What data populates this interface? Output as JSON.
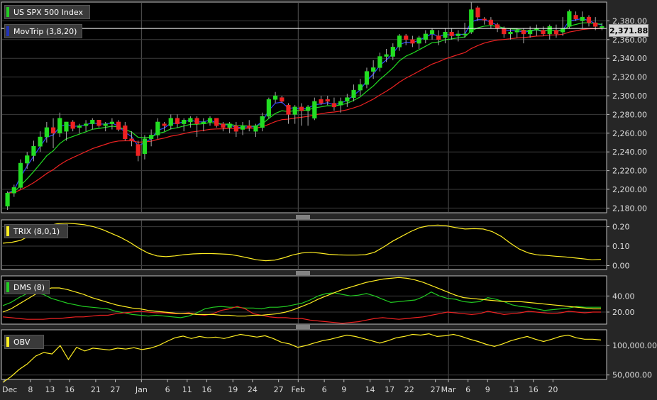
{
  "chart_data": [
    {
      "type": "candlestick",
      "panel": "price",
      "series": [
        {
          "name": "US SPX 500 Index",
          "color": "#22cc22",
          "legend_swatch": "#22cc22"
        },
        {
          "name": "MovTrip (3,8,20)",
          "legend_swatch": "#2233bb",
          "lines": [
            "#3344ff",
            "#22dd22",
            "#ee2222"
          ]
        }
      ],
      "last_value_label": "2,371.88",
      "last_value": 2371.88,
      "ylim": [
        2175,
        2400
      ],
      "yticks": [
        {
          "v": 2180,
          "label": "2,180.00"
        },
        {
          "v": 2200,
          "label": "2,200.00"
        },
        {
          "v": 2220,
          "label": "2,220.00"
        },
        {
          "v": 2240,
          "label": "2,240.00"
        },
        {
          "v": 2260,
          "label": "2,260.00"
        },
        {
          "v": 2280,
          "label": "2,280.00"
        },
        {
          "v": 2300,
          "label": "2,300.00"
        },
        {
          "v": 2320,
          "label": "2,320.00"
        },
        {
          "v": 2340,
          "label": "2,340.00"
        },
        {
          "v": 2360,
          "label": "2,360.00"
        },
        {
          "v": 2380,
          "label": "2,380.00"
        }
      ],
      "candles": [
        [
          2182,
          2198,
          2178,
          2196
        ],
        [
          2196,
          2205,
          2192,
          2202
        ],
        [
          2202,
          2232,
          2200,
          2228
        ],
        [
          2228,
          2240,
          2222,
          2236
        ],
        [
          2236,
          2252,
          2230,
          2246
        ],
        [
          2246,
          2262,
          2240,
          2256
        ],
        [
          2256,
          2272,
          2250,
          2266
        ],
        [
          2266,
          2276,
          2244,
          2260
        ],
        [
          2260,
          2282,
          2256,
          2276
        ],
        [
          2262,
          2272,
          2252,
          2272
        ],
        [
          2272,
          2274,
          2262,
          2265
        ],
        [
          2266,
          2270,
          2260,
          2268
        ],
        [
          2268,
          2274,
          2262,
          2270
        ],
        [
          2270,
          2276,
          2264,
          2274
        ],
        [
          2274,
          2274,
          2266,
          2268
        ],
        [
          2268,
          2272,
          2262,
          2270
        ],
        [
          2270,
          2276,
          2264,
          2272
        ],
        [
          2272,
          2274,
          2262,
          2264
        ],
        [
          2268,
          2272,
          2252,
          2254
        ],
        [
          2254,
          2262,
          2246,
          2252
        ],
        [
          2248,
          2252,
          2230,
          2236
        ],
        [
          2238,
          2258,
          2232,
          2254
        ],
        [
          2254,
          2264,
          2246,
          2258
        ],
        [
          2258,
          2276,
          2254,
          2272
        ],
        [
          2270,
          2272,
          2262,
          2268
        ],
        [
          2268,
          2280,
          2264,
          2276
        ],
        [
          2276,
          2280,
          2266,
          2270
        ],
        [
          2270,
          2276,
          2262,
          2274
        ],
        [
          2272,
          2278,
          2266,
          2276
        ],
        [
          2276,
          2278,
          2256,
          2270
        ],
        [
          2270,
          2276,
          2262,
          2272
        ],
        [
          2272,
          2278,
          2268,
          2276
        ],
        [
          2276,
          2276,
          2266,
          2268
        ],
        [
          2270,
          2272,
          2262,
          2266
        ],
        [
          2266,
          2272,
          2260,
          2270
        ],
        [
          2268,
          2272,
          2256,
          2262
        ],
        [
          2264,
          2272,
          2258,
          2268
        ],
        [
          2268,
          2274,
          2262,
          2266
        ],
        [
          2262,
          2270,
          2256,
          2268
        ],
        [
          2266,
          2282,
          2262,
          2278
        ],
        [
          2278,
          2298,
          2276,
          2296
        ],
        [
          2296,
          2304,
          2292,
          2300
        ],
        [
          2298,
          2300,
          2292,
          2294
        ],
        [
          2290,
          2292,
          2270,
          2280
        ],
        [
          2280,
          2290,
          2270,
          2288
        ],
        [
          2288,
          2292,
          2268,
          2284
        ],
        [
          2284,
          2290,
          2268,
          2288
        ],
        [
          2276,
          2298,
          2274,
          2294
        ],
        [
          2296,
          2300,
          2290,
          2292
        ],
        [
          2296,
          2300,
          2290,
          2294
        ],
        [
          2292,
          2298,
          2284,
          2288
        ],
        [
          2290,
          2298,
          2282,
          2294
        ],
        [
          2294,
          2302,
          2288,
          2298
        ],
        [
          2298,
          2312,
          2294,
          2306
        ],
        [
          2306,
          2318,
          2300,
          2312
        ],
        [
          2312,
          2330,
          2308,
          2326
        ],
        [
          2326,
          2338,
          2318,
          2330
        ],
        [
          2330,
          2346,
          2326,
          2342
        ],
        [
          2342,
          2350,
          2336,
          2344
        ],
        [
          2342,
          2356,
          2338,
          2352
        ],
        [
          2352,
          2366,
          2348,
          2364
        ],
        [
          2364,
          2366,
          2354,
          2360
        ],
        [
          2360,
          2364,
          2352,
          2356
        ],
        [
          2356,
          2364,
          2350,
          2362
        ],
        [
          2360,
          2370,
          2356,
          2366
        ],
        [
          2366,
          2372,
          2360,
          2370
        ],
        [
          2364,
          2370,
          2354,
          2360
        ],
        [
          2362,
          2372,
          2356,
          2368
        ],
        [
          2368,
          2372,
          2360,
          2364
        ],
        [
          2364,
          2370,
          2358,
          2366
        ],
        [
          2366,
          2378,
          2362,
          2366
        ],
        [
          2368,
          2400,
          2366,
          2392
        ],
        [
          2394,
          2396,
          2380,
          2384
        ],
        [
          2382,
          2384,
          2376,
          2381
        ],
        [
          2381,
          2384,
          2372,
          2376
        ],
        [
          2376,
          2378,
          2368,
          2372
        ],
        [
          2372,
          2374,
          2362,
          2366
        ],
        [
          2366,
          2372,
          2360,
          2368
        ],
        [
          2368,
          2372,
          2362,
          2370
        ],
        [
          2370,
          2372,
          2356,
          2366
        ],
        [
          2366,
          2374,
          2362,
          2370
        ],
        [
          2370,
          2376,
          2364,
          2372
        ],
        [
          2370,
          2374,
          2364,
          2366
        ],
        [
          2366,
          2376,
          2360,
          2374
        ],
        [
          2370,
          2376,
          2362,
          2366
        ],
        [
          2368,
          2384,
          2364,
          2372
        ],
        [
          2374,
          2392,
          2372,
          2390
        ],
        [
          2386,
          2390,
          2380,
          2382
        ],
        [
          2380,
          2390,
          2372,
          2384
        ],
        [
          2384,
          2386,
          2374,
          2378
        ],
        [
          2378,
          2384,
          2370,
          2374
        ],
        [
          2374,
          2378,
          2370,
          2374
        ]
      ]
    },
    {
      "type": "line",
      "panel": "trix",
      "series": [
        {
          "name": "TRIX (8,0,1)",
          "color": "#ffee22",
          "values": [
            0.115,
            0.12,
            0.13,
            0.155,
            0.185,
            0.205,
            0.215,
            0.218,
            0.215,
            0.21,
            0.2,
            0.185,
            0.165,
            0.145,
            0.12,
            0.09,
            0.065,
            0.05,
            0.046,
            0.05,
            0.056,
            0.06,
            0.062,
            0.062,
            0.06,
            0.058,
            0.05,
            0.04,
            0.03,
            0.025,
            0.028,
            0.04,
            0.055,
            0.065,
            0.068,
            0.064,
            0.058,
            0.055,
            0.054,
            0.054,
            0.056,
            0.068,
            0.095,
            0.125,
            0.15,
            0.175,
            0.195,
            0.205,
            0.208,
            0.204,
            0.195,
            0.188,
            0.19,
            0.188,
            0.175,
            0.15,
            0.115,
            0.085,
            0.065,
            0.055,
            0.052,
            0.048,
            0.045,
            0.04,
            0.035,
            0.03,
            0.032
          ]
        }
      ],
      "ylim": [
        -0.02,
        0.235
      ],
      "yticks": [
        {
          "v": 0.0,
          "label": "0.00"
        },
        {
          "v": 0.1,
          "label": "0.10"
        },
        {
          "v": 0.2,
          "label": "0.20"
        }
      ]
    },
    {
      "type": "line",
      "panel": "dms",
      "series": [
        {
          "name": "DMS (8)",
          "color": "#22cc22",
          "values": [
            28,
            32,
            38,
            43,
            44,
            42,
            37,
            34,
            31,
            29,
            27,
            26,
            25,
            24,
            21,
            19,
            17,
            16,
            15,
            16,
            15,
            14,
            13,
            15,
            19,
            24,
            26,
            27,
            26,
            26,
            25,
            25,
            24,
            26,
            26,
            27,
            29,
            31,
            35,
            40,
            43,
            44,
            42,
            40,
            41,
            43,
            40,
            36,
            32,
            33,
            34,
            35,
            39,
            45,
            40,
            37,
            36,
            33,
            32,
            33,
            38,
            36,
            33,
            29,
            27,
            26,
            24,
            22,
            23,
            24,
            25,
            27,
            26,
            26,
            26
          ]
        },
        {
          "name": "-DI",
          "color": "#ee2222",
          "values": [
            14,
            13,
            12,
            11,
            11,
            11,
            12,
            12,
            13,
            14,
            14,
            15,
            16,
            16,
            18,
            19,
            20,
            21,
            20,
            19,
            19,
            18,
            18,
            19,
            17,
            16,
            18,
            22,
            24,
            27,
            24,
            18,
            16,
            14,
            13,
            13,
            12,
            12,
            10,
            9,
            8,
            7,
            6,
            7,
            8,
            10,
            12,
            13,
            12,
            11,
            12,
            13,
            14,
            16,
            18,
            20,
            19,
            18,
            17,
            18,
            21,
            19,
            17,
            18,
            19,
            21,
            20,
            19,
            18,
            19,
            21,
            20,
            19,
            20,
            20
          ]
        },
        {
          "name": "ADX",
          "color": "#ffee22",
          "values": [
            20,
            24,
            30,
            36,
            42,
            47,
            50,
            50,
            48,
            45,
            42,
            38,
            35,
            32,
            29,
            27,
            25,
            24,
            22,
            21,
            20,
            19,
            18,
            18,
            17,
            17,
            17,
            16,
            16,
            15,
            15,
            16,
            16,
            17,
            18,
            20,
            23,
            27,
            31,
            36,
            40,
            44,
            48,
            51,
            54,
            57,
            59,
            61,
            62,
            63,
            62,
            60,
            57,
            53,
            49,
            45,
            41,
            38,
            37,
            36,
            35,
            34,
            33,
            33,
            33,
            32,
            31,
            30,
            29,
            28,
            27,
            26,
            25,
            24,
            24
          ]
        }
      ],
      "ylim": [
        5,
        65
      ],
      "yticks": [
        {
          "v": 20,
          "label": "20.00"
        },
        {
          "v": 40,
          "label": "40.00"
        }
      ]
    },
    {
      "type": "line",
      "panel": "obv",
      "y_scale": "log",
      "series": [
        {
          "name": "OBV",
          "color": "#ffee22",
          "values": [
            42000,
            48000,
            57000,
            65000,
            78000,
            85000,
            82000,
            100000,
            72000,
            96000,
            88000,
            94000,
            92000,
            90000,
            94000,
            92000,
            95000,
            91000,
            94000,
            100000,
            110000,
            120000,
            125000,
            118000,
            124000,
            120000,
            122000,
            118000,
            124000,
            130000,
            126000,
            122000,
            126000,
            118000,
            108000,
            104000,
            96000,
            100000,
            106000,
            112000,
            116000,
            122000,
            128000,
            124000,
            118000,
            112000,
            106000,
            112000,
            120000,
            124000,
            130000,
            128000,
            132000,
            124000,
            126000,
            130000,
            124000,
            116000,
            110000,
            103000,
            98000,
            104000,
            112000,
            118000,
            124000,
            116000,
            110000,
            116000,
            124000,
            128000,
            120000,
            116000,
            116000,
            114000
          ]
        }
      ],
      "ylim": [
        45000,
        145000
      ],
      "yticks": [
        {
          "v": 50000,
          "label": "50,000.00"
        },
        {
          "v": 100000,
          "label": "100,000.00"
        }
      ]
    }
  ],
  "x_axis": {
    "ticks": [
      {
        "i": 0,
        "label": "Dec"
      },
      {
        "i": 4,
        "label": "8"
      },
      {
        "i": 7,
        "label": "13"
      },
      {
        "i": 10,
        "label": "16"
      },
      {
        "i": 14,
        "label": "21"
      },
      {
        "i": 17,
        "label": "27"
      },
      {
        "i": 21,
        "label": "Jan"
      },
      {
        "i": 25,
        "label": "6"
      },
      {
        "i": 28,
        "label": "11"
      },
      {
        "i": 31,
        "label": "16"
      },
      {
        "i": 35,
        "label": "19"
      },
      {
        "i": 38,
        "label": "24"
      },
      {
        "i": 42,
        "label": "27"
      },
      {
        "i": 45,
        "label": "Feb"
      },
      {
        "i": 49,
        "label": "6"
      },
      {
        "i": 52,
        "label": "9"
      },
      {
        "i": 56,
        "label": "14"
      },
      {
        "i": 59,
        "label": "17"
      },
      {
        "i": 62,
        "label": "22"
      },
      {
        "i": 66,
        "label": "27"
      },
      {
        "i": 68,
        "label": "Mar"
      },
      {
        "i": 71,
        "label": "6"
      },
      {
        "i": 74,
        "label": "9"
      },
      {
        "i": 78,
        "label": "13"
      },
      {
        "i": 81,
        "label": "16"
      },
      {
        "i": 84,
        "label": "20"
      }
    ],
    "month_boundaries": [
      21,
      45,
      68
    ]
  },
  "colors": {
    "up": "#22dd22",
    "down": "#ee2222",
    "grid": "#3c3c3c",
    "axis_text": "#dddddd",
    "background": "#000000",
    "frame": "#bdbdbd"
  }
}
